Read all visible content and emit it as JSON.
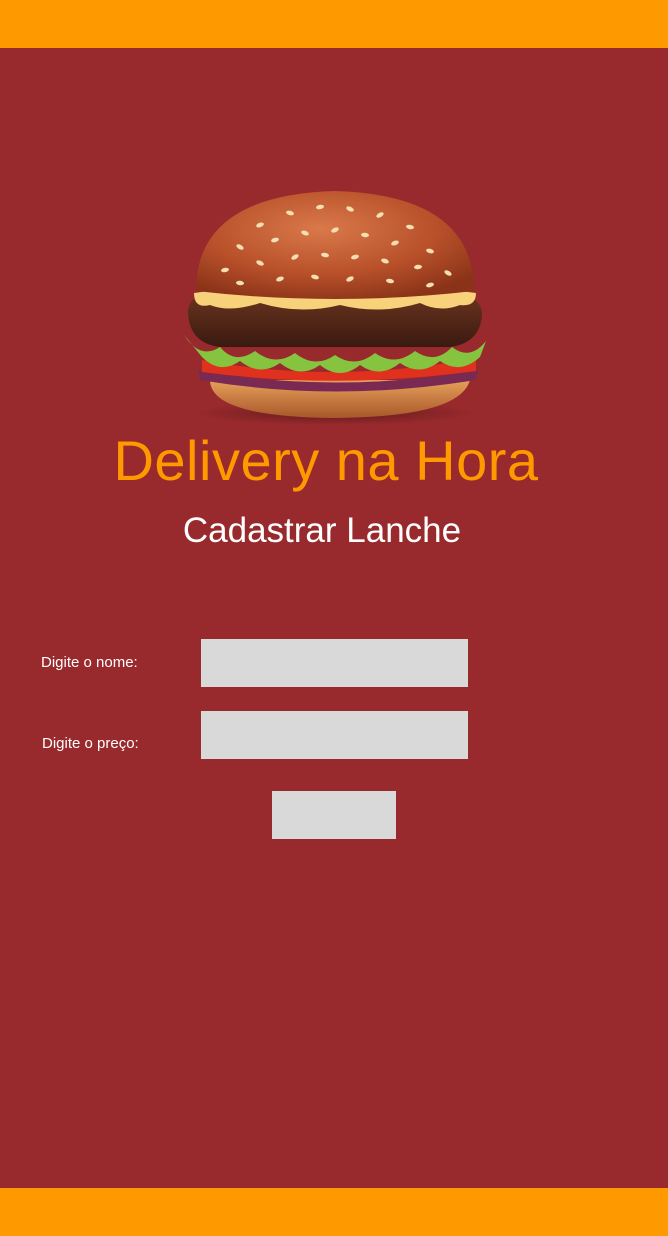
{
  "header": {},
  "hero": {
    "image_name": "burger-image"
  },
  "app_title": "Delivery na Hora",
  "page_title": "Cadastrar Lanche",
  "form": {
    "name_label": "Digite o nome:",
    "name_value": "",
    "price_label": "Digite o preço:",
    "price_value": "",
    "submit_label": ""
  },
  "colors": {
    "background": "#98292c",
    "accent": "#ff9900",
    "input_bg": "#d9d9d9",
    "text": "#ffffff"
  }
}
